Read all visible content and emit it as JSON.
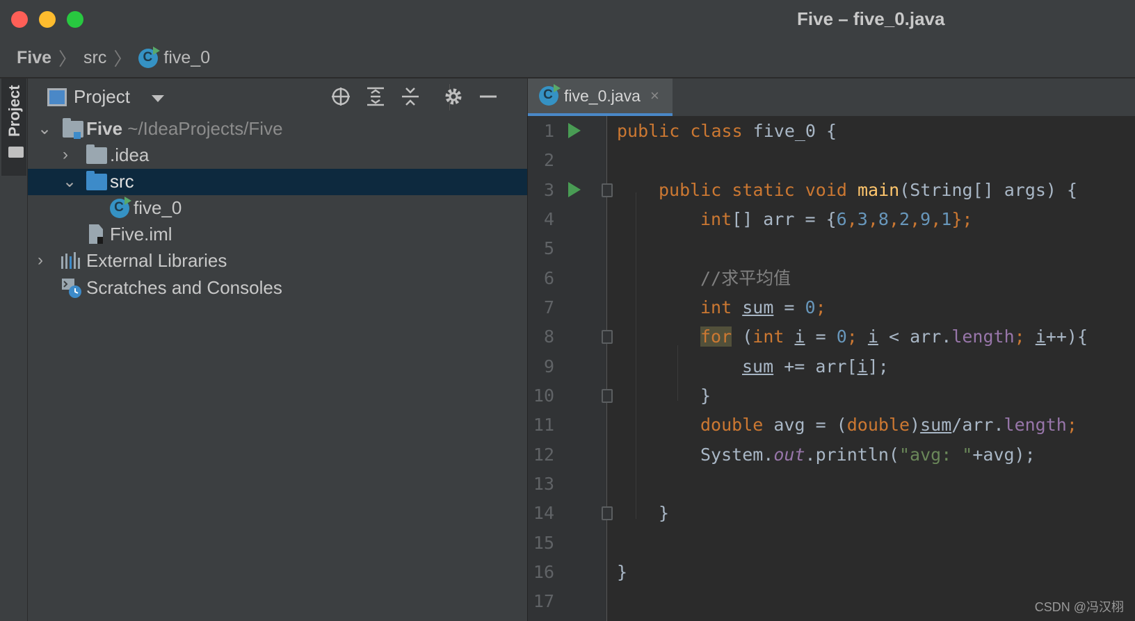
{
  "window": {
    "title": "Five – five_0.java",
    "traffic_lights": {
      "close": "#ff5f57",
      "minimize": "#febc2e",
      "zoom": "#28c840"
    }
  },
  "breadcrumb": {
    "project": "Five",
    "folder": "src",
    "file": "five_0",
    "separator": "〉"
  },
  "toolstrip": {
    "project_tab_label": "Project"
  },
  "project_panel": {
    "title": "Project",
    "tree": {
      "root_name": "Five",
      "root_path": "~/IdeaProjects/Five",
      "idea": ".idea",
      "src": "src",
      "file": "five_0",
      "iml": "Five.iml",
      "libraries": "External Libraries",
      "scratches": "Scratches and Consoles"
    }
  },
  "editor": {
    "tab_label": "five_0.java",
    "tab_close": "×",
    "line_numbers": [
      "1",
      "2",
      "3",
      "4",
      "5",
      "6",
      "7",
      "8",
      "9",
      "10",
      "11",
      "12",
      "13",
      "14",
      "15",
      "16",
      "17"
    ],
    "code": {
      "l1": {
        "kw": "public class",
        "name": " five_0 {"
      },
      "l3": {
        "kw": "public static void",
        "fn": "main",
        "rest": "(String[] args) {"
      },
      "l4": {
        "kw": "int",
        "a": "[] arr = {",
        "n1": "6",
        "n2": "3",
        "n3": "8",
        "n4": "2",
        "n5": "9",
        "n6": "1",
        "end": "};"
      },
      "l6": {
        "comment": "//求平均值"
      },
      "l7": {
        "kw": "int",
        "var": "sum",
        "eq": " = ",
        "num": "0",
        "semi": ";"
      },
      "l8": {
        "kw": "for",
        "p1": " (",
        "kw2": "int",
        "sp": " ",
        "i1": "i",
        "eq": " = ",
        "num": "0",
        "semi": ";",
        "sp2": " ",
        "i2": "i",
        "lt": " < arr.",
        "len": "length",
        "semi2": ";",
        "sp3": " ",
        "i3": "i",
        "end": "++){"
      },
      "l9": {
        "var": "sum",
        "op": " += arr[",
        "i": "i",
        "end": "];"
      },
      "l10": {
        "brace": "}"
      },
      "l11": {
        "kw": "double",
        "a": " avg = (",
        "kw2": "double",
        "b": ")",
        "var": "sum",
        "c": "/arr.",
        "len": "length",
        "semi": ";"
      },
      "l12": {
        "a": "System.",
        "out": "out",
        "b": ".println(",
        "str": "\"avg: \"",
        "c": "+avg);"
      },
      "l14": {
        "brace": "}"
      },
      "l16": {
        "brace": "}"
      }
    }
  },
  "watermark": "CSDN @冯汉栩"
}
